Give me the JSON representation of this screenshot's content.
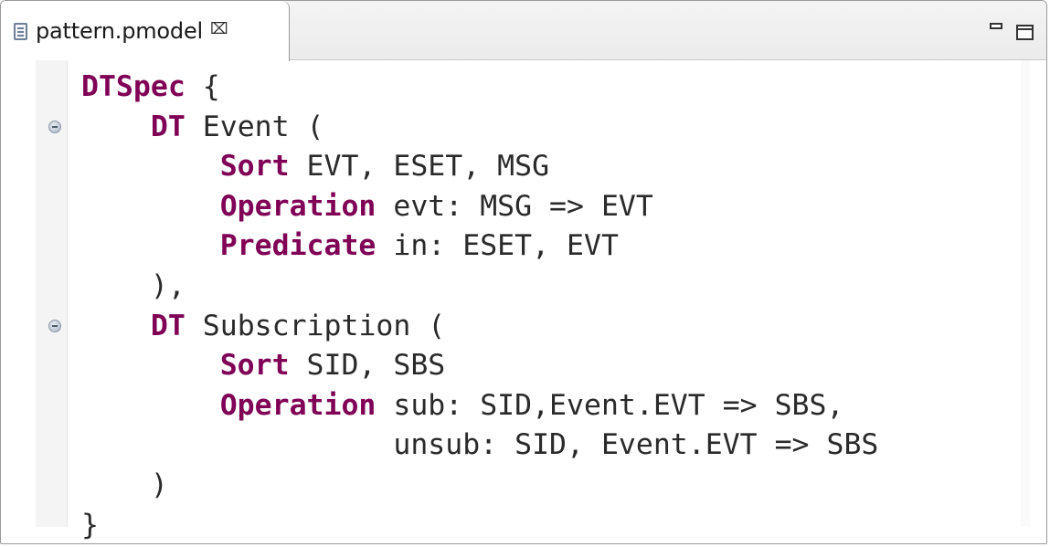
{
  "tab": {
    "title": "pattern.pmodel",
    "close_glyph": "⌧",
    "file_icon": "file-icon"
  },
  "window_controls": [
    "minimize",
    "maximize"
  ],
  "colors": {
    "keyword": "#7f0055",
    "text": "#2a2a2a"
  },
  "code_lines": [
    [
      {
        "t": "DTSpec",
        "k": true
      },
      {
        "t": " {",
        "k": false
      }
    ],
    [
      {
        "t": "    ",
        "k": false
      },
      {
        "t": "DT",
        "k": true
      },
      {
        "t": " Event (",
        "k": false
      }
    ],
    [
      {
        "t": "        ",
        "k": false
      },
      {
        "t": "Sort",
        "k": true
      },
      {
        "t": " EVT, ESET, MSG",
        "k": false
      }
    ],
    [
      {
        "t": "        ",
        "k": false
      },
      {
        "t": "Operation",
        "k": true
      },
      {
        "t": " evt: MSG => EVT",
        "k": false
      }
    ],
    [
      {
        "t": "        ",
        "k": false
      },
      {
        "t": "Predicate",
        "k": true
      },
      {
        "t": " in: ESET, EVT",
        "k": false
      }
    ],
    [
      {
        "t": "    ),",
        "k": false
      }
    ],
    [
      {
        "t": "    ",
        "k": false
      },
      {
        "t": "DT",
        "k": true
      },
      {
        "t": " Subscription (",
        "k": false
      }
    ],
    [
      {
        "t": "        ",
        "k": false
      },
      {
        "t": "Sort",
        "k": true
      },
      {
        "t": " SID, SBS",
        "k": false
      }
    ],
    [
      {
        "t": "        ",
        "k": false
      },
      {
        "t": "Operation",
        "k": true
      },
      {
        "t": " sub: SID,Event.EVT => SBS,",
        "k": false
      }
    ],
    [
      {
        "t": "                  unsub: SID, Event.EVT => SBS",
        "k": false
      }
    ],
    [
      {
        "t": "    )",
        "k": false
      }
    ],
    [
      {
        "t": "}",
        "k": false
      }
    ]
  ],
  "fold_markers_on_lines": [
    1,
    6
  ]
}
